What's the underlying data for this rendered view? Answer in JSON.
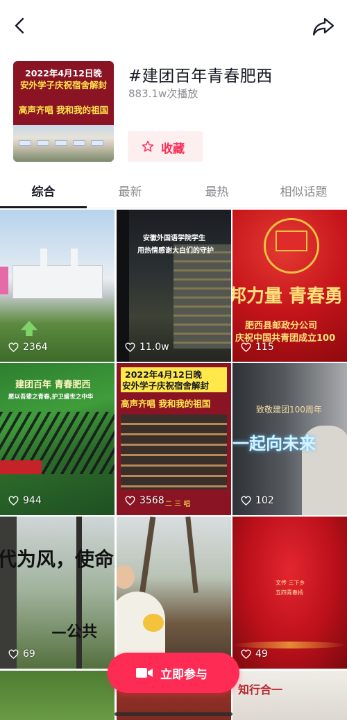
{
  "topbar": {
    "back_icon": "chevron-left-icon",
    "share_icon": "share-arrow-icon"
  },
  "topic": {
    "title": "#建团百年青春肥西",
    "plays": "883.1w次播放",
    "cover": {
      "line1": "2022年4月12日晚",
      "line2": "安外学子庆祝宿舍解封",
      "line3": "高声齐唱 我和我的祖国"
    },
    "favorite_label": "收藏",
    "favorite_icon": "star-outline-icon"
  },
  "tabs": [
    {
      "label": "综合",
      "active": true
    },
    {
      "label": "最新",
      "active": false
    },
    {
      "label": "最热",
      "active": false
    },
    {
      "label": "相似话题",
      "active": false
    }
  ],
  "videos": [
    {
      "likes": "2364"
    },
    {
      "likes": "11.0w",
      "caption1": "安徽外国语学院学生",
      "caption2": "用热情感谢大白们的守护"
    },
    {
      "likes": "115",
      "caption1": "邦力量 青春勇",
      "caption2": "肥西县邮政分公司",
      "caption3": "庆祝中国共青团成立100"
    },
    {
      "likes": "944",
      "caption1": "建团百年 青春肥西",
      "caption2": "愿以吾辈之青春,护卫盛世之中华"
    },
    {
      "likes": "3568",
      "caption1": "2022年4月12日晚",
      "caption2": "安外学子庆祝宿舍解封",
      "caption3": "高声齐唱 我和我的祖国",
      "caption4": "二 三 唱"
    },
    {
      "likes": "102",
      "caption1": "致敬建团100周年",
      "caption2": "一起向未来"
    },
    {
      "likes": "69",
      "caption1": "代为风，使命光",
      "caption2": "—公共"
    },
    {
      "likes": "",
      "caption1": ""
    },
    {
      "likes": "49",
      "caption1": "文传 三下乡",
      "caption2": "五四青春扬"
    },
    {
      "likes": ""
    },
    {
      "likes": ""
    },
    {
      "likes": "",
      "caption1": "知行合一"
    }
  ],
  "cta": {
    "label": "立即参与",
    "icon": "video-camera-icon"
  },
  "colors": {
    "accent": "#fe2c55",
    "text": "#161823",
    "muted": "#8a8b91"
  }
}
